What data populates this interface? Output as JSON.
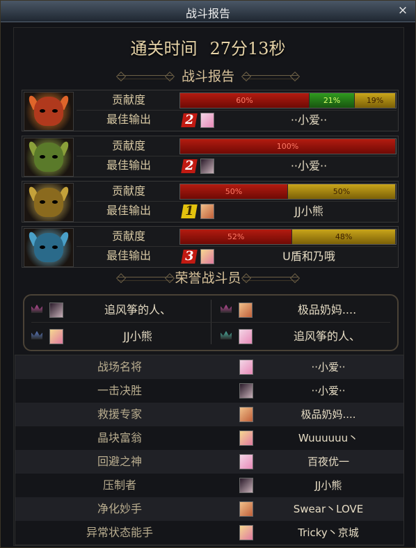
{
  "window": {
    "title": "战斗报告",
    "close_glyph": "×"
  },
  "clear_time": {
    "label": "通关时间",
    "value": "27分13秒"
  },
  "sections": {
    "report": "战斗报告",
    "honor": "荣誉战斗员"
  },
  "bosses": [
    {
      "icon": "red-demon-helmet-icon",
      "contrib_label": "贡献度",
      "best_label": "最佳输出",
      "segments": [
        {
          "pct": 60,
          "text": "60%",
          "color": "red"
        },
        {
          "pct": 21,
          "text": "21%",
          "color": "green"
        },
        {
          "pct": 19,
          "text": "19%",
          "color": "gold"
        }
      ],
      "rank": "2",
      "rank_color": "red",
      "player": "··小爱··"
    },
    {
      "icon": "green-demon-helmet-icon",
      "contrib_label": "贡献度",
      "best_label": "最佳输出",
      "segments": [
        {
          "pct": 100,
          "text": "100%",
          "color": "red"
        }
      ],
      "rank": "2",
      "rank_color": "red",
      "player": "··小爱··"
    },
    {
      "icon": "gold-demon-helmet-icon",
      "contrib_label": "贡献度",
      "best_label": "最佳输出",
      "segments": [
        {
          "pct": 50,
          "text": "50%",
          "color": "red"
        },
        {
          "pct": 50,
          "text": "50%",
          "color": "gold"
        }
      ],
      "rank": "1",
      "rank_color": "gold",
      "player": "JJ小熊"
    },
    {
      "icon": "blue-demon-helmet-icon",
      "contrib_label": "贡献度",
      "best_label": "最佳输出",
      "segments": [
        {
          "pct": 52,
          "text": "52%",
          "color": "red"
        },
        {
          "pct": 48,
          "text": "48%",
          "color": "gold"
        }
      ],
      "rank": "3",
      "rank_color": "red",
      "player": "U盾和乃哦"
    }
  ],
  "honor": [
    {
      "name": "追风筝的人、",
      "badge_color": "#c04a9a"
    },
    {
      "name": "极品奶妈....",
      "badge_color": "#c04a9a"
    },
    {
      "name": "JJ小熊",
      "badge_color": "#5a7ac0"
    },
    {
      "name": "追风筝的人、",
      "badge_color": "#4ab0a0"
    }
  ],
  "awards": [
    {
      "title": "战场名将",
      "player": "··小爱··"
    },
    {
      "title": "一击决胜",
      "player": "··小爱··"
    },
    {
      "title": "救援专家",
      "player": "极品奶妈...."
    },
    {
      "title": "晶块富翁",
      "player": "Wuuuuuu丶"
    },
    {
      "title": "回避之神",
      "player": "百夜优一"
    },
    {
      "title": "压制者",
      "player": "JJ小熊"
    },
    {
      "title": "净化妙手",
      "player": "Swear丶LOVE"
    },
    {
      "title": "异常状态能手",
      "player": "Tricky丶京城"
    }
  ],
  "colors": {
    "red_bar": "#b31b10",
    "green_bar": "#2f9a1e",
    "gold_bar": "#c9a51a",
    "accent_text": "#d8c29a"
  }
}
